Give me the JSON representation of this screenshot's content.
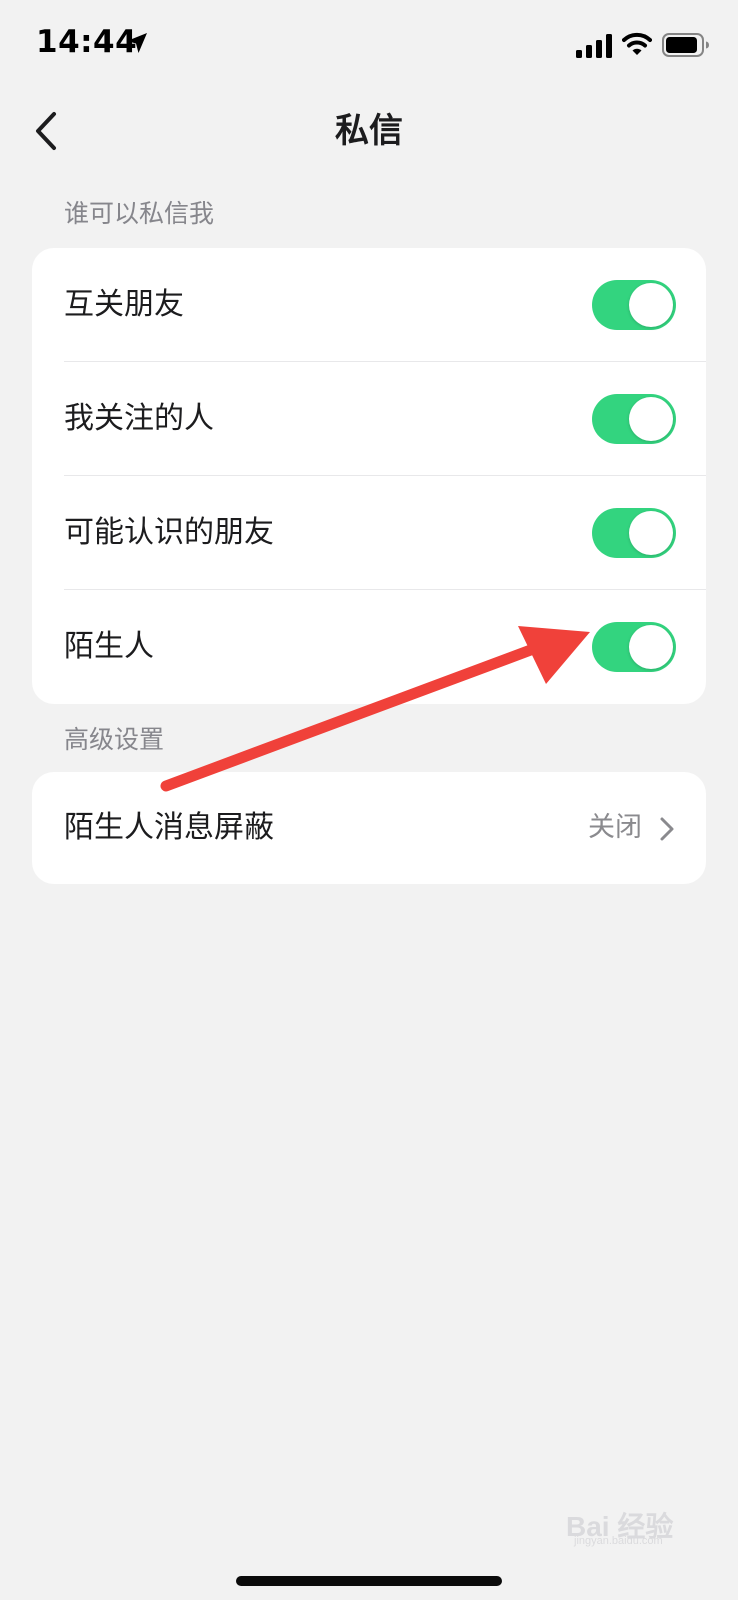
{
  "status_bar": {
    "time": "14:44",
    "icons": [
      "location-arrow-icon",
      "signal-icon",
      "wifi-icon",
      "battery-icon"
    ],
    "battery_level": 0.85
  },
  "nav": {
    "title": "私信",
    "back_icon": "chevron-left-icon"
  },
  "sections": [
    {
      "header": "谁可以私信我",
      "items": [
        {
          "label": "互关朋友",
          "toggle_on": true
        },
        {
          "label": "我关注的人",
          "toggle_on": true
        },
        {
          "label": "可能认识的朋友",
          "toggle_on": true
        },
        {
          "label": "陌生人",
          "toggle_on": true
        }
      ]
    },
    {
      "header": "高级设置",
      "items": [
        {
          "label": "陌生人消息屏蔽",
          "value": "关闭",
          "icon": "chevron-right-icon"
        }
      ]
    }
  ],
  "colors": {
    "toggle_on": "#33d47f",
    "background": "#f2f2f2",
    "card": "#ffffff",
    "annotation_arrow": "#f0413a"
  },
  "watermark": {
    "text": "Bai 经验",
    "sub": "jingyan.baidu.com"
  }
}
